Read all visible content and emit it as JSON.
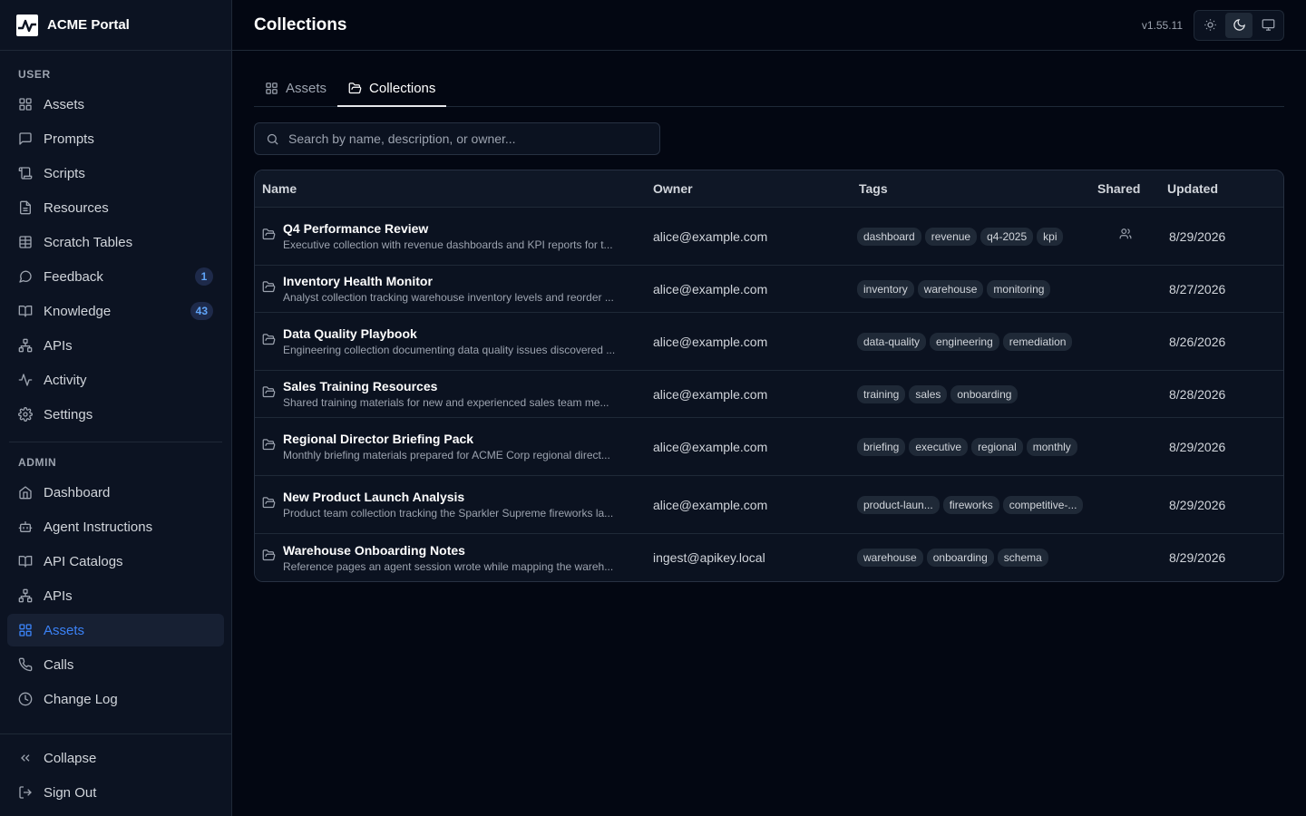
{
  "app": {
    "name": "ACME Portal",
    "version": "v1.55.11"
  },
  "sidebar": {
    "user_label": "USER",
    "user_items": [
      {
        "label": "Assets",
        "icon": "grid-icon"
      },
      {
        "label": "Prompts",
        "icon": "message-square-icon"
      },
      {
        "label": "Scripts",
        "icon": "scroll-icon"
      },
      {
        "label": "Resources",
        "icon": "file-icon"
      },
      {
        "label": "Scratch Tables",
        "icon": "table-icon"
      },
      {
        "label": "Feedback",
        "icon": "message-circle-icon",
        "badge": "1"
      },
      {
        "label": "Knowledge",
        "icon": "book-icon",
        "badge": "43"
      },
      {
        "label": "APIs",
        "icon": "network-icon"
      },
      {
        "label": "Activity",
        "icon": "activity-icon"
      },
      {
        "label": "Settings",
        "icon": "gear-icon"
      }
    ],
    "admin_label": "ADMIN",
    "admin_items": [
      {
        "label": "Dashboard",
        "icon": "home-icon"
      },
      {
        "label": "Agent Instructions",
        "icon": "bot-icon"
      },
      {
        "label": "API Catalogs",
        "icon": "book-open-icon"
      },
      {
        "label": "APIs",
        "icon": "network-icon"
      },
      {
        "label": "Assets",
        "icon": "grid-icon",
        "active": true
      },
      {
        "label": "Calls",
        "icon": "phone-icon"
      },
      {
        "label": "Change Log",
        "icon": "clock-icon"
      }
    ],
    "collapse": "Collapse",
    "signout": "Sign Out"
  },
  "header": {
    "title": "Collections",
    "theme_options": [
      "light",
      "dark",
      "system"
    ],
    "theme_selected": "dark"
  },
  "tabs": [
    {
      "label": "Assets",
      "icon": "grid-icon"
    },
    {
      "label": "Collections",
      "icon": "folder-icon",
      "active": true
    }
  ],
  "search": {
    "placeholder": "Search by name, description, or owner...",
    "value": ""
  },
  "table": {
    "columns": [
      "Name",
      "Owner",
      "Tags",
      "Shared",
      "Updated"
    ],
    "rows": [
      {
        "name": "Q4 Performance Review",
        "desc": "Executive collection with revenue dashboards and KPI reports for t...",
        "owner": "alice@example.com",
        "tags": [
          "dashboard",
          "revenue",
          "q4-2025",
          "kpi"
        ],
        "shared": true,
        "updated": "8/29/2026"
      },
      {
        "name": "Inventory Health Monitor",
        "desc": "Analyst collection tracking warehouse inventory levels and reorder ...",
        "owner": "alice@example.com",
        "tags": [
          "inventory",
          "warehouse",
          "monitoring"
        ],
        "shared": false,
        "updated": "8/27/2026"
      },
      {
        "name": "Data Quality Playbook",
        "desc": "Engineering collection documenting data quality issues discovered ...",
        "owner": "alice@example.com",
        "tags": [
          "data-quality",
          "engineering",
          "remediation"
        ],
        "shared": false,
        "updated": "8/26/2026"
      },
      {
        "name": "Sales Training Resources",
        "desc": "Shared training materials for new and experienced sales team me...",
        "owner": "alice@example.com",
        "tags": [
          "training",
          "sales",
          "onboarding"
        ],
        "shared": false,
        "updated": "8/28/2026"
      },
      {
        "name": "Regional Director Briefing Pack",
        "desc": "Monthly briefing materials prepared for ACME Corp regional direct...",
        "owner": "alice@example.com",
        "tags": [
          "briefing",
          "executive",
          "regional",
          "monthly"
        ],
        "shared": false,
        "updated": "8/29/2026"
      },
      {
        "name": "New Product Launch Analysis",
        "desc": "Product team collection tracking the Sparkler Supreme fireworks la...",
        "owner": "alice@example.com",
        "tags": [
          "product-laun...",
          "fireworks",
          "competitive-..."
        ],
        "shared": false,
        "updated": "8/29/2026"
      },
      {
        "name": "Warehouse Onboarding Notes",
        "desc": "Reference pages an agent session wrote while mapping the wareh...",
        "owner": "ingest@apikey.local",
        "tags": [
          "warehouse",
          "onboarding",
          "schema"
        ],
        "shared": false,
        "updated": "8/29/2026"
      }
    ]
  }
}
